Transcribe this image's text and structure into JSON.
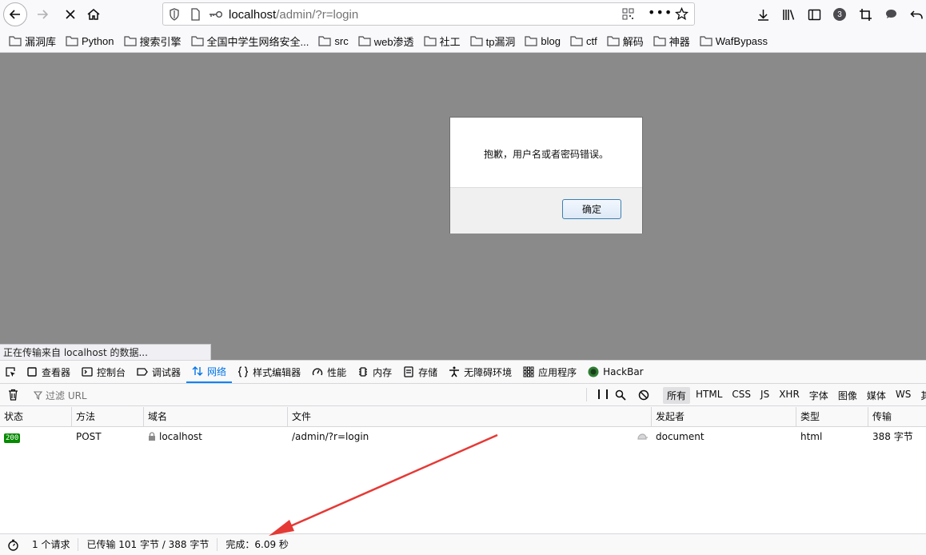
{
  "toolbar": {
    "url_host": "localhost",
    "url_path": "/admin/?r=login",
    "notification_count": "3"
  },
  "bookmarks": [
    {
      "label": "漏洞库"
    },
    {
      "label": "Python"
    },
    {
      "label": "搜索引擎"
    },
    {
      "label": "全国中学生网络安全..."
    },
    {
      "label": "src"
    },
    {
      "label": "web渗透"
    },
    {
      "label": "社工"
    },
    {
      "label": "tp漏洞"
    },
    {
      "label": "blog"
    },
    {
      "label": "ctf"
    },
    {
      "label": "解码"
    },
    {
      "label": "神器"
    },
    {
      "label": "WafBypass"
    }
  ],
  "dialog": {
    "message": "抱歉，用户名或者密码错误。",
    "ok_label": "确定"
  },
  "status_overlay": "正在传输来自 localhost 的数据...",
  "devtools": {
    "tabs": [
      {
        "label": "查看器"
      },
      {
        "label": "控制台"
      },
      {
        "label": "调试器"
      },
      {
        "label": "网络"
      },
      {
        "label": "样式编辑器"
      },
      {
        "label": "性能"
      },
      {
        "label": "内存"
      },
      {
        "label": "存储"
      },
      {
        "label": "无障碍环境"
      },
      {
        "label": "应用程序"
      },
      {
        "label": "HackBar"
      }
    ],
    "filter_placeholder": "过滤 URL",
    "filter_types": [
      "所有",
      "HTML",
      "CSS",
      "JS",
      "XHR",
      "字体",
      "图像",
      "媒体",
      "WS",
      "其"
    ],
    "columns": [
      "状态",
      "方法",
      "域名",
      "文件",
      "发起者",
      "类型",
      "传输"
    ],
    "request": {
      "status": "200",
      "method": "POST",
      "domain": "localhost",
      "file": "/admin/?r=login",
      "initiator": "document",
      "type": "html",
      "transferred": "388 字节"
    },
    "footer": {
      "requests": "1 个请求",
      "transferred": "已传输 101 字节 / 388 字节",
      "finish": "完成：6.09 秒"
    }
  },
  "colors": {
    "accent": "#0a84ff",
    "status_ok": "#058b00",
    "annotation_arrow": "#e53935"
  }
}
